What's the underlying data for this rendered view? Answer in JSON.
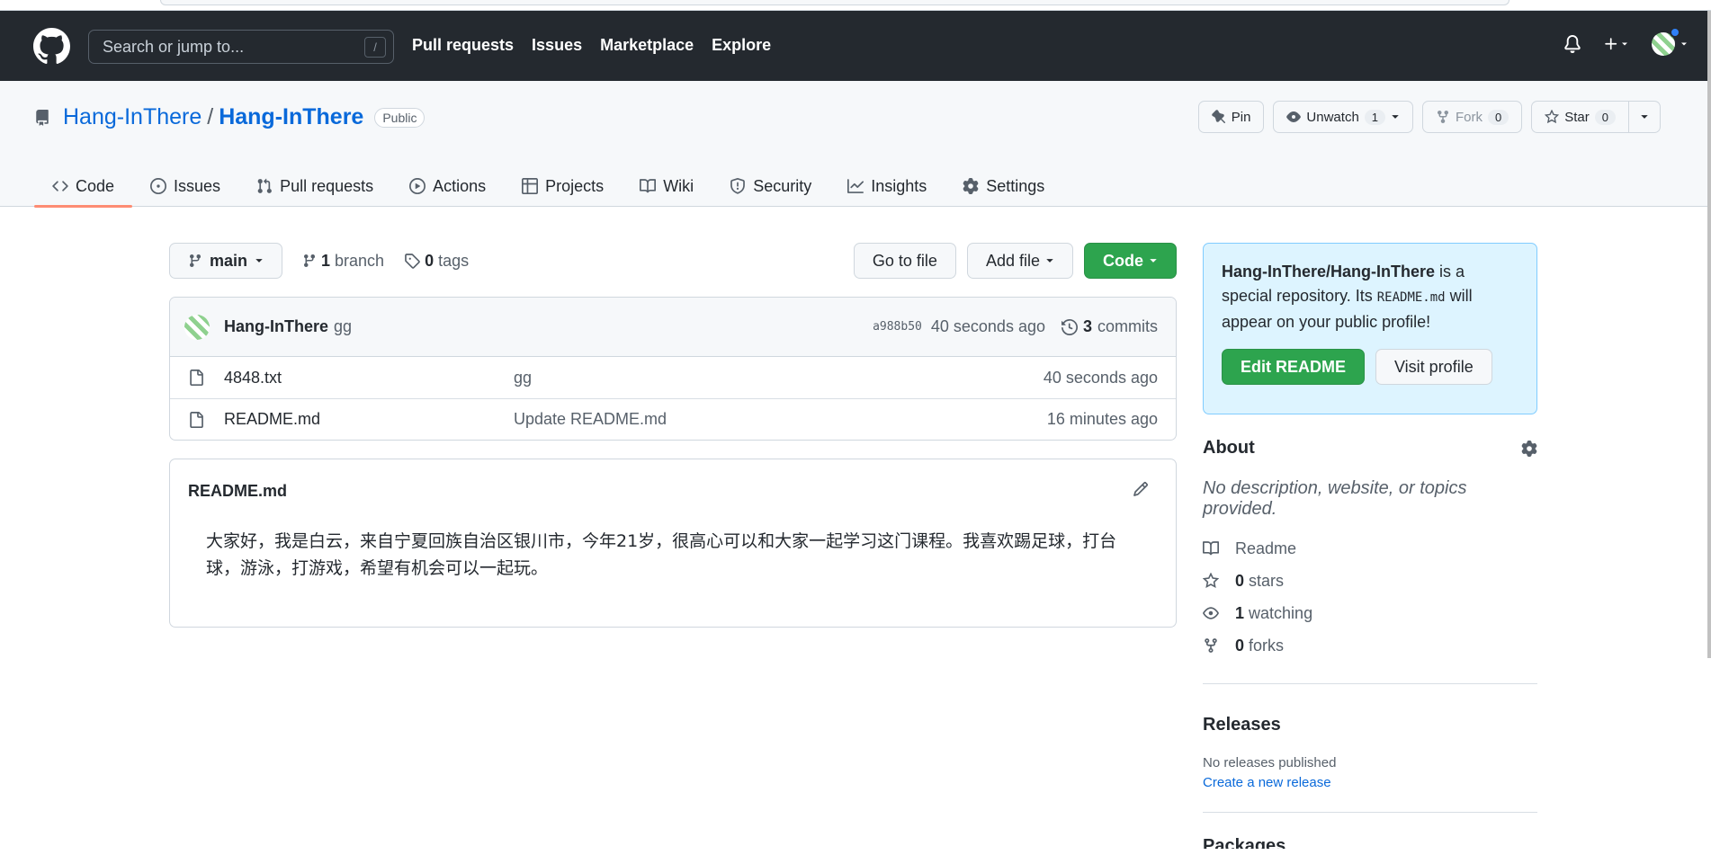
{
  "header": {
    "search_placeholder": "Search or jump to...",
    "search_shortcut": "/",
    "nav": [
      "Pull requests",
      "Issues",
      "Marketplace",
      "Explore"
    ]
  },
  "repo": {
    "owner": "Hang-InThere",
    "separator": "/",
    "name": "Hang-InThere",
    "visibility": "Public",
    "actions": {
      "pin": "Pin",
      "unwatch": "Unwatch",
      "watch_count": "1",
      "fork": "Fork",
      "fork_count": "0",
      "star": "Star",
      "star_count": "0"
    },
    "tabs": [
      {
        "label": "Code",
        "icon": "code-icon"
      },
      {
        "label": "Issues",
        "icon": "issue-icon"
      },
      {
        "label": "Pull requests",
        "icon": "pull-request-icon"
      },
      {
        "label": "Actions",
        "icon": "play-icon"
      },
      {
        "label": "Projects",
        "icon": "table-icon"
      },
      {
        "label": "Wiki",
        "icon": "book-icon"
      },
      {
        "label": "Security",
        "icon": "shield-icon"
      },
      {
        "label": "Insights",
        "icon": "graph-icon"
      },
      {
        "label": "Settings",
        "icon": "gear-icon"
      }
    ]
  },
  "toolbar": {
    "branch": "main",
    "branch_count": "1",
    "branch_label": "branch",
    "tag_count": "0",
    "tag_label": "tags",
    "go_to_file": "Go to file",
    "add_file": "Add file",
    "code": "Code"
  },
  "commit": {
    "author": "Hang-InThere",
    "message": "gg",
    "sha": "a988b50",
    "ago": "40 seconds ago",
    "commit_count": "3",
    "commit_label": "commits"
  },
  "files": [
    {
      "name": "4848.txt",
      "message": "gg",
      "age": "40 seconds ago"
    },
    {
      "name": "README.md",
      "message": "Update README.md",
      "age": "16 minutes ago"
    }
  ],
  "readme": {
    "title": "README.md",
    "body": "大家好，我是白云，来自宁夏回族自治区银川市，今年21岁，很高心可以和大家一起学习这门课程。我喜欢踢足球，打台球，游泳，打游戏，希望有机会可以一起玩。"
  },
  "sidebar": {
    "special_repo": "Hang-InThere/Hang-InThere",
    "special_text_1": " is a special repository. Its ",
    "special_code": "README.md",
    "special_text_2": " will appear on your public profile!",
    "edit_readme": "Edit README",
    "visit_profile": "Visit profile",
    "about_title": "About",
    "about_desc": "No description, website, or topics provided.",
    "readme_label": "Readme",
    "stars_count": "0",
    "stars_label": "stars",
    "watching_count": "1",
    "watching_label": "watching",
    "forks_count": "0",
    "forks_label": "forks",
    "releases_title": "Releases",
    "no_releases": "No releases published",
    "create_release": "Create a new release",
    "packages_title": "Packages"
  },
  "colors": {
    "header_bg": "#24292f",
    "link": "#0969da",
    "green": "#2da44e",
    "tab_underline": "#fd8c73",
    "special_bg": "#ddf4ff"
  }
}
